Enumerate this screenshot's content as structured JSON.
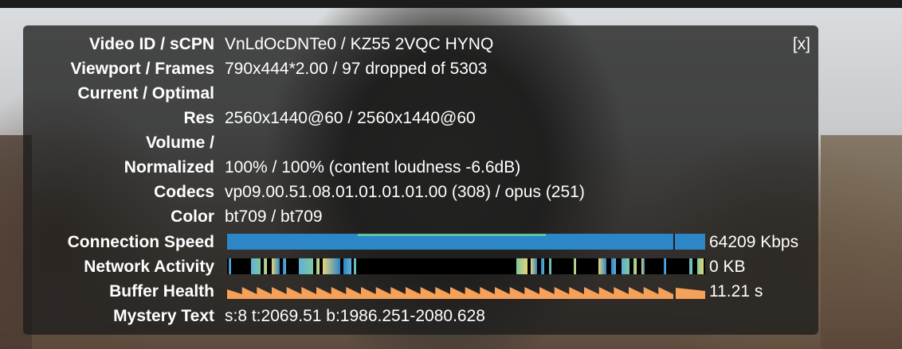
{
  "close_label": "[x]",
  "rows": {
    "video_id": {
      "label": "Video ID / sCPN",
      "value": "VnLdOcDNTe0 / KZ55 2VQC HYNQ"
    },
    "viewport": {
      "label": "Viewport / Frames",
      "value": "790x444*2.00 / 97 dropped of 5303"
    },
    "current_optimal": {
      "label": "Current / Optimal",
      "value": ""
    },
    "res": {
      "label": "Res",
      "value": "2560x1440@60 / 2560x1440@60"
    },
    "volume": {
      "label": "Volume /",
      "value": ""
    },
    "normalized": {
      "label": "Normalized",
      "value": "100% / 100% (content loudness -6.6dB)"
    },
    "codecs": {
      "label": "Codecs",
      "value": "vp09.00.51.08.01.01.01.01.00 (308) / opus (251)"
    },
    "color": {
      "label": "Color",
      "value": "bt709 / bt709"
    },
    "connection_speed": {
      "label": "Connection Speed",
      "readout": "64209 Kbps",
      "fill_fraction": 1.0,
      "colors": {
        "bar": "#2d86c6",
        "peak": "#5cc6a0"
      }
    },
    "network_activity": {
      "label": "Network Activity",
      "readout": "0 KB",
      "colors": [
        "#2d86c6",
        "#5fb0d8",
        "#7cc8a0",
        "#e6d47a"
      ]
    },
    "buffer_health": {
      "label": "Buffer Health",
      "readout": "11.21 s",
      "colors": {
        "fill": "#f5a15a"
      }
    },
    "mystery_text": {
      "label": "Mystery Text",
      "value": "s:8 t:2069.51 b:1986.251-2080.628"
    }
  }
}
